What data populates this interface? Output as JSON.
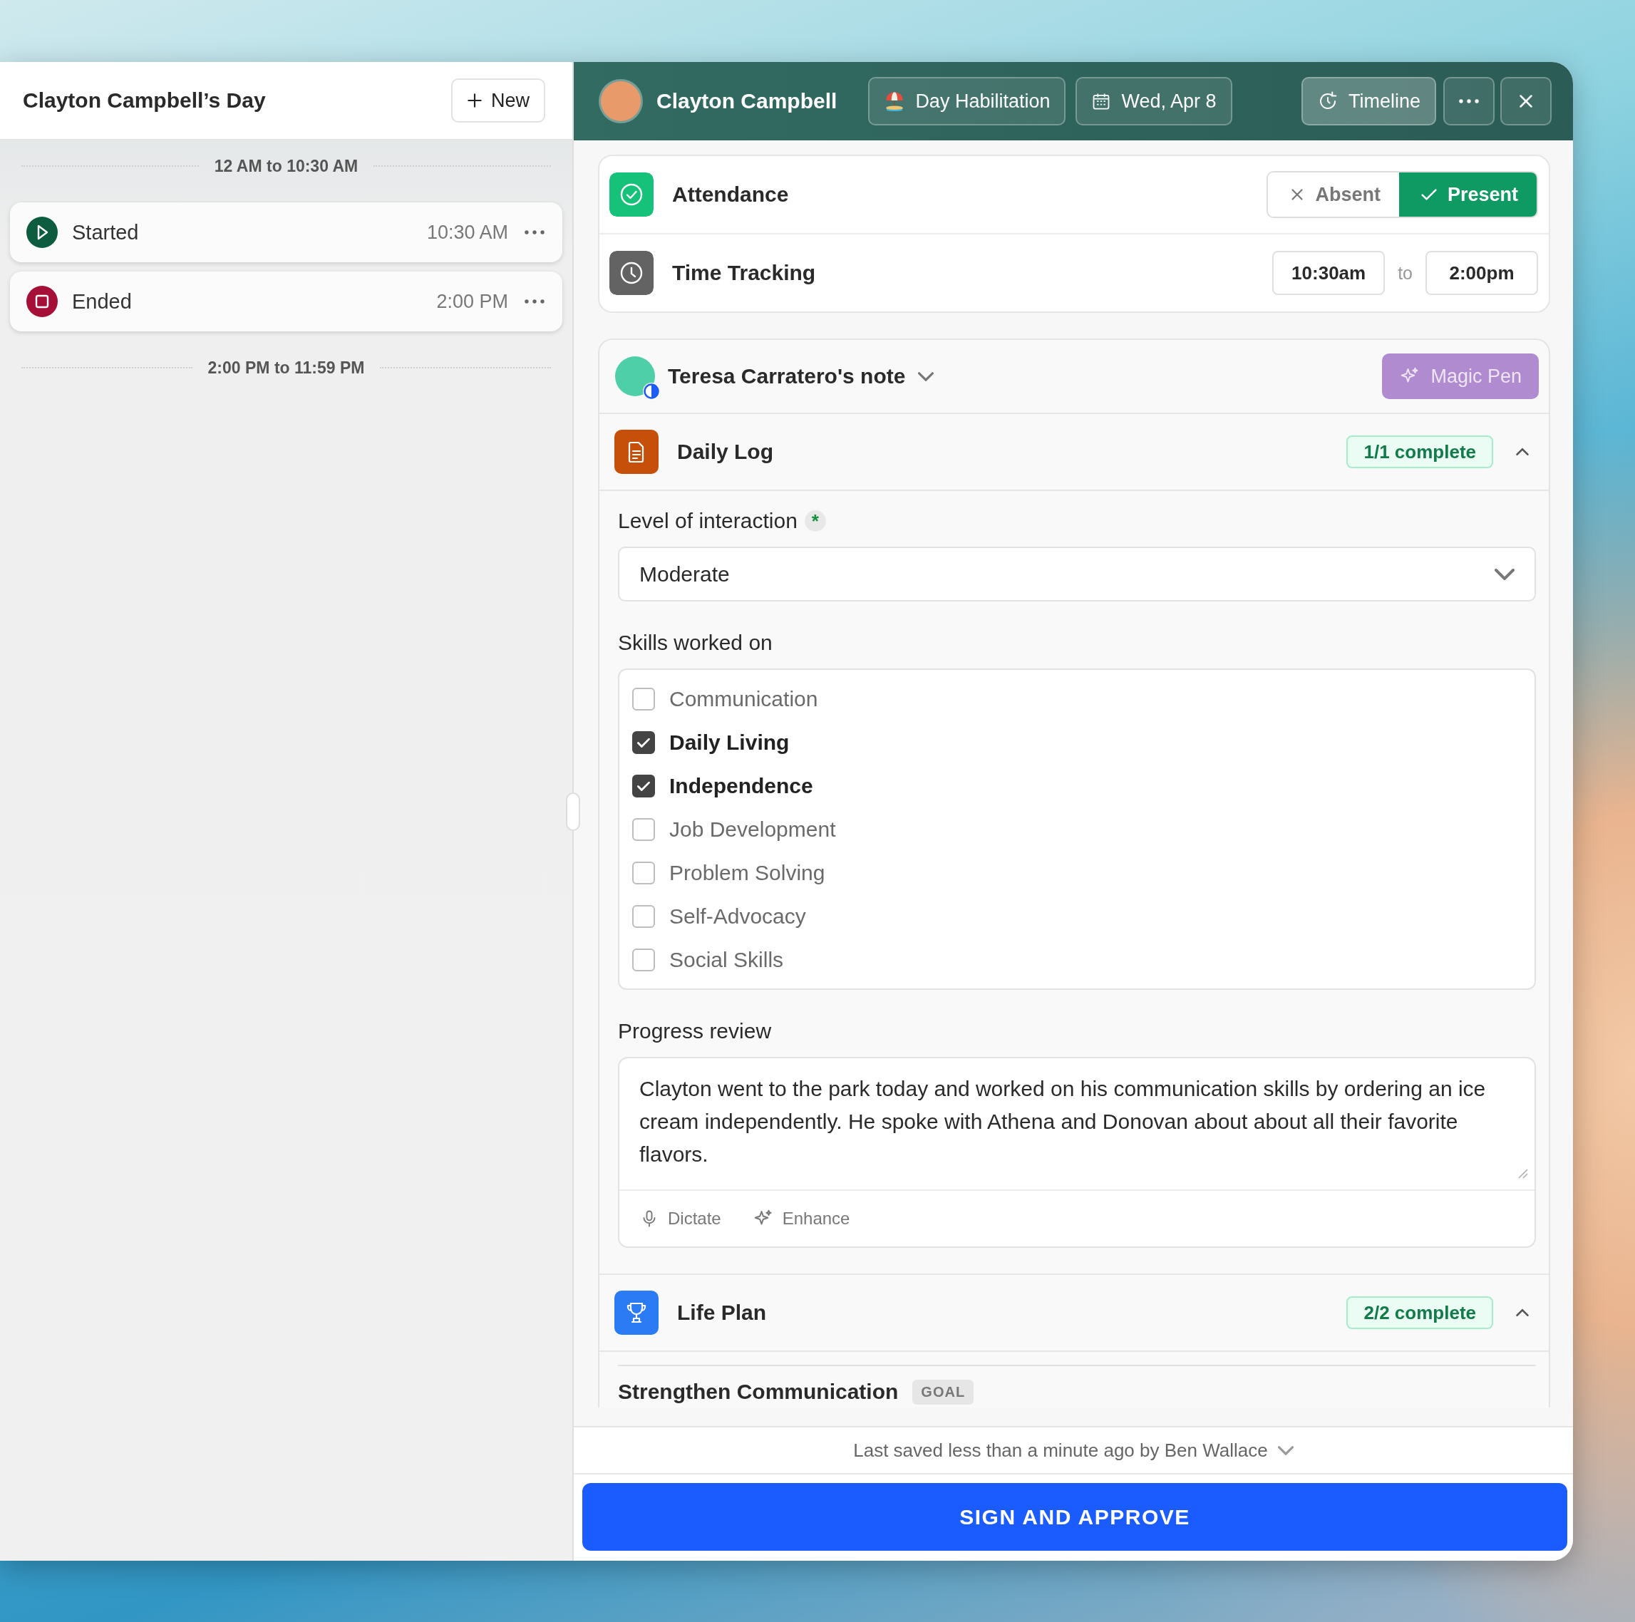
{
  "sidebar": {
    "title": "Clayton Campbell’s Day",
    "new_button": "New",
    "items": [
      {
        "kind": "divider",
        "label": "12 AM to 10:30 AM"
      },
      {
        "kind": "start",
        "label": "Started",
        "time": "10:30 AM"
      },
      {
        "kind": "end",
        "label": "Ended",
        "time": "2:00 PM"
      },
      {
        "kind": "divider",
        "label": "2:00 PM to 11:59 PM"
      }
    ]
  },
  "header": {
    "client_name": "Clayton Campbell",
    "service": "Day Habilitation",
    "date": "Wed, Apr 8",
    "timeline_button": "Timeline"
  },
  "attendance": {
    "label": "Attendance",
    "options": [
      {
        "kind": "absent",
        "label": "Absent",
        "selected": false
      },
      {
        "kind": "present",
        "label": "Present",
        "selected": true
      }
    ]
  },
  "time_tracking": {
    "label": "Time Tracking",
    "start": "10:30am",
    "separator": "to",
    "end": "2:00pm"
  },
  "note": {
    "author": "Teresa Carratero's note",
    "magic_pen_button": "Magic Pen",
    "sections": [
      {
        "kind": "daily_log",
        "title": "Daily Log",
        "status": "1/1 complete",
        "expanded": true,
        "level_label": "Level of interaction",
        "required_mark": "*",
        "level_value": "Moderate",
        "skills_label": "Skills worked on",
        "skills": [
          {
            "label": "Communication",
            "checked": false
          },
          {
            "label": "Daily Living",
            "checked": true
          },
          {
            "label": "Independence",
            "checked": true
          },
          {
            "label": "Job Development",
            "checked": false
          },
          {
            "label": "Problem Solving",
            "checked": false
          },
          {
            "label": "Self-Advocacy",
            "checked": false
          },
          {
            "label": "Social Skills",
            "checked": false
          }
        ],
        "progress_label": "Progress review",
        "progress_text": "Clayton went to the park today and worked on his communication skills by ordering an ice cream independently. He spoke with Athena and Donovan about about all their favorite flavors.",
        "tools": [
          {
            "kind": "dictate",
            "label": "Dictate"
          },
          {
            "kind": "enhance",
            "label": "Enhance"
          }
        ]
      },
      {
        "kind": "life_plan",
        "title": "Life Plan",
        "status": "2/2 complete",
        "expanded": true,
        "goals": [
          {
            "title": "Strengthen Communication",
            "tag": "GOAL"
          }
        ]
      }
    ]
  },
  "footer": {
    "last_saved": "Last saved less than a minute ago by Ben Wallace",
    "sign_button": "SIGN AND APPROVE"
  }
}
